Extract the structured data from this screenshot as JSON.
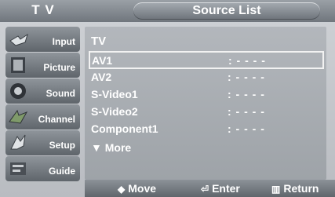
{
  "header": {
    "tv_label": "T V",
    "title": "Source List"
  },
  "sidebar": {
    "items": [
      {
        "label": "Input",
        "icon": "input-icon"
      },
      {
        "label": "Picture",
        "icon": "picture-icon"
      },
      {
        "label": "Sound",
        "icon": "sound-icon"
      },
      {
        "label": "Channel",
        "icon": "channel-icon"
      },
      {
        "label": "Setup",
        "icon": "setup-icon"
      },
      {
        "label": "Guide",
        "icon": "guide-icon"
      }
    ]
  },
  "list": {
    "header": "TV",
    "rows": [
      {
        "name": "AV1",
        "value": ": - - - -"
      },
      {
        "name": "AV2",
        "value": ": - - - -"
      },
      {
        "name": "S-Video1",
        "value": ": - - - -"
      },
      {
        "name": "S-Video2",
        "value": ": - - - -"
      },
      {
        "name": "Component1",
        "value": ": - - - -"
      }
    ],
    "more": "▼ More"
  },
  "footer": {
    "move": "Move",
    "enter": "Enter",
    "return": "Return"
  }
}
